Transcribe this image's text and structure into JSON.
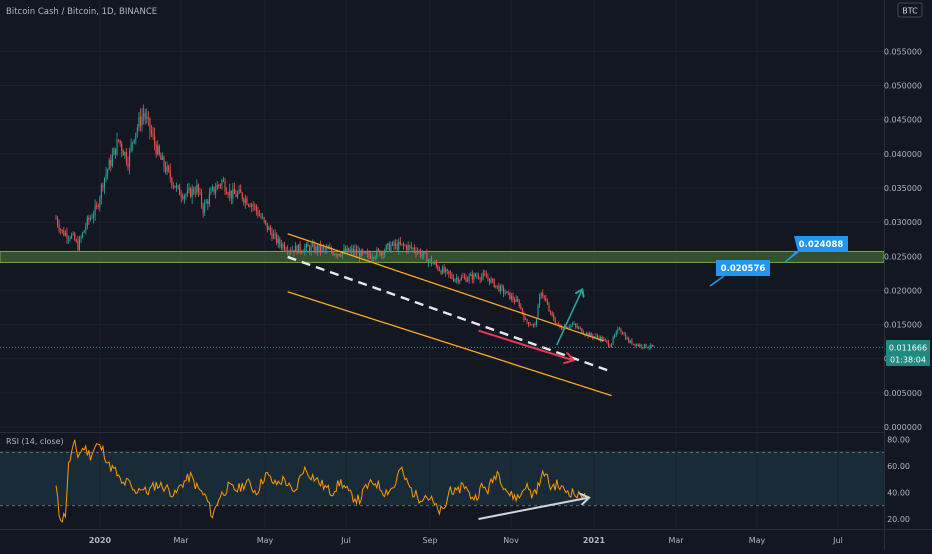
{
  "title": "Bitcoin Cash / Bitcoin, 1D, BINANCE",
  "currency_badge": "BTC",
  "rsi_label": "RSI (14, close)",
  "price_axis": {
    "ticks": [
      0.055,
      0.05,
      0.045,
      0.04,
      0.035,
      0.03,
      0.025,
      0.02,
      0.015,
      0.01,
      0.005,
      0.0
    ],
    "labels": [
      "0.055000",
      "0.050000",
      "0.045000",
      "0.040000",
      "0.035000",
      "0.030000",
      "0.025000",
      "0.020000",
      "0.015000",
      "0.010000",
      "0.005000",
      "0.000000"
    ]
  },
  "rsi_axis": {
    "ticks": [
      80,
      60,
      40,
      20
    ],
    "labels": [
      "80.00",
      "60.00",
      "40.00",
      "20.00"
    ],
    "band": [
      30,
      70
    ]
  },
  "time_axis": [
    "2020",
    "Mar",
    "May",
    "Jul",
    "Sep",
    "Nov",
    "2021",
    "Mar",
    "May",
    "Jul"
  ],
  "current_price": {
    "value": "0.011666",
    "countdown": "01:38:04"
  },
  "callouts": [
    {
      "label": "0.024088"
    },
    {
      "label": "0.020576"
    }
  ],
  "colors": {
    "up": "#26a69a",
    "down": "#ef5350",
    "channel": "#ffa726",
    "zone": "#3b5b2e",
    "zone_border": "#8bc34a",
    "rsi": "#ff9800",
    "rsi_band": "#1e3340",
    "callout": "#2196f3",
    "price_tag": "#1f8a82",
    "arrow_up": "#26a69a",
    "arrow_red": "#e53950",
    "axis_text": "#b2b5be"
  },
  "chart_data": {
    "type": "candlestick",
    "symbol": "BCHBTC",
    "interval": "1D",
    "xlabel": "",
    "ylabel": "",
    "ylim": [
      0.0,
      0.0585
    ],
    "close_path": [
      [
        0,
        0.0305
      ],
      [
        4,
        0.0285
      ],
      [
        10,
        0.028
      ],
      [
        14,
        0.0265
      ],
      [
        20,
        0.03
      ],
      [
        26,
        0.032
      ],
      [
        30,
        0.036
      ],
      [
        36,
        0.0395
      ],
      [
        40,
        0.042
      ],
      [
        46,
        0.039
      ],
      [
        50,
        0.043
      ],
      [
        56,
        0.046
      ],
      [
        60,
        0.0435
      ],
      [
        66,
        0.0395
      ],
      [
        72,
        0.037
      ],
      [
        78,
        0.0345
      ],
      [
        84,
        0.034
      ],
      [
        90,
        0.035
      ],
      [
        94,
        0.032
      ],
      [
        100,
        0.0345
      ],
      [
        106,
        0.036
      ],
      [
        112,
        0.034
      ],
      [
        118,
        0.034
      ],
      [
        126,
        0.0325
      ],
      [
        134,
        0.0295
      ],
      [
        142,
        0.027
      ],
      [
        150,
        0.026
      ],
      [
        160,
        0.0262
      ],
      [
        170,
        0.026
      ],
      [
        180,
        0.0255
      ],
      [
        190,
        0.0258
      ],
      [
        198,
        0.025
      ],
      [
        206,
        0.0255
      ],
      [
        214,
        0.0265
      ],
      [
        222,
        0.0265
      ],
      [
        230,
        0.026
      ],
      [
        238,
        0.0245
      ],
      [
        246,
        0.023
      ],
      [
        254,
        0.0218
      ],
      [
        262,
        0.0218
      ],
      [
        270,
        0.0222
      ],
      [
        276,
        0.0218
      ],
      [
        282,
        0.0205
      ],
      [
        288,
        0.0195
      ],
      [
        296,
        0.018
      ],
      [
        300,
        0.0155
      ],
      [
        306,
        0.0148
      ],
      [
        310,
        0.02
      ],
      [
        316,
        0.0165
      ],
      [
        322,
        0.0145
      ],
      [
        330,
        0.015
      ],
      [
        340,
        0.0135
      ],
      [
        348,
        0.013
      ],
      [
        354,
        0.012
      ],
      [
        360,
        0.0145
      ],
      [
        366,
        0.0125
      ],
      [
        372,
        0.012
      ],
      [
        378,
        0.0118
      ],
      [
        382,
        0.0117
      ]
    ],
    "rsi_path": [
      [
        0,
        44
      ],
      [
        2,
        24
      ],
      [
        4,
        20
      ],
      [
        6,
        24
      ],
      [
        8,
        60
      ],
      [
        10,
        70
      ],
      [
        12,
        76
      ],
      [
        14,
        68
      ],
      [
        18,
        74
      ],
      [
        22,
        68
      ],
      [
        26,
        76
      ],
      [
        30,
        72
      ],
      [
        34,
        60
      ],
      [
        38,
        56
      ],
      [
        42,
        46
      ],
      [
        46,
        48
      ],
      [
        50,
        40
      ],
      [
        54,
        44
      ],
      [
        58,
        40
      ],
      [
        64,
        46
      ],
      [
        70,
        44
      ],
      [
        76,
        38
      ],
      [
        80,
        46
      ],
      [
        86,
        52
      ],
      [
        90,
        44
      ],
      [
        96,
        36
      ],
      [
        100,
        22
      ],
      [
        104,
        36
      ],
      [
        110,
        44
      ],
      [
        116,
        42
      ],
      [
        122,
        48
      ],
      [
        128,
        40
      ],
      [
        134,
        54
      ],
      [
        140,
        46
      ],
      [
        146,
        50
      ],
      [
        152,
        38
      ],
      [
        158,
        58
      ],
      [
        164,
        52
      ],
      [
        170,
        46
      ],
      [
        176,
        40
      ],
      [
        182,
        48
      ],
      [
        188,
        38
      ],
      [
        194,
        34
      ],
      [
        198,
        44
      ],
      [
        204,
        48
      ],
      [
        210,
        40
      ],
      [
        216,
        44
      ],
      [
        220,
        58
      ],
      [
        224,
        48
      ],
      [
        228,
        40
      ],
      [
        232,
        36
      ],
      [
        236,
        38
      ],
      [
        240,
        34
      ],
      [
        244,
        26
      ],
      [
        248,
        26
      ],
      [
        252,
        44
      ],
      [
        256,
        38
      ],
      [
        260,
        48
      ],
      [
        264,
        38
      ],
      [
        268,
        36
      ],
      [
        272,
        44
      ],
      [
        276,
        42
      ],
      [
        282,
        56
      ],
      [
        286,
        46
      ],
      [
        290,
        38
      ],
      [
        296,
        36
      ],
      [
        300,
        46
      ],
      [
        304,
        38
      ],
      [
        308,
        44
      ],
      [
        312,
        56
      ],
      [
        316,
        44
      ],
      [
        320,
        46
      ],
      [
        324,
        42
      ],
      [
        330,
        40
      ],
      [
        334,
        37
      ],
      [
        338,
        41
      ]
    ],
    "support_zone": [
      0.0241,
      0.0257
    ],
    "channel": {
      "upper": [
        [
          148,
          0.0283
        ],
        [
          350,
          0.0126
        ]
      ],
      "mid": [
        [
          148,
          0.0249
        ],
        [
          355,
          0.0081
        ]
      ],
      "lower": [
        [
          148,
          0.0198
        ],
        [
          355,
          0.0046
        ]
      ]
    },
    "projection_arrow": [
      [
        320,
        0.012
      ],
      [
        336,
        0.02
      ]
    ],
    "divergence_arrows": {
      "price": [
        [
          270,
          0.0141
        ],
        [
          330,
          0.0098
        ]
      ],
      "rsi": [
        [
          270,
          20
        ],
        [
          340,
          36
        ]
      ]
    }
  }
}
